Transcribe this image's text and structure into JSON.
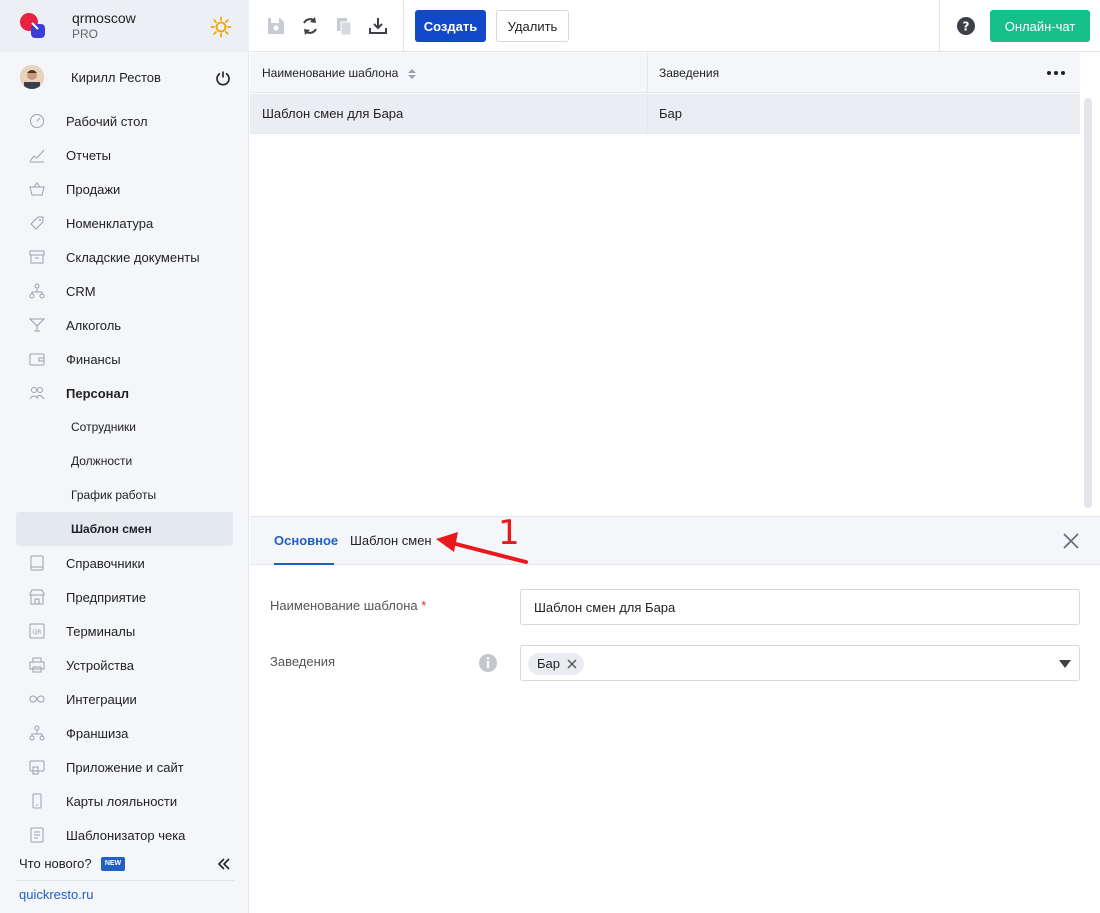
{
  "brand": {
    "name": "qrmoscow",
    "plan": "PRO"
  },
  "user": {
    "name": "Кирилл Рестов"
  },
  "nav": {
    "items": [
      {
        "label": "Рабочий стол",
        "icon": "dashboard-icon"
      },
      {
        "label": "Отчеты",
        "icon": "reports-icon"
      },
      {
        "label": "Продажи",
        "icon": "basket-icon"
      },
      {
        "label": "Номенклатура",
        "icon": "tag-icon"
      },
      {
        "label": "Складские документы",
        "icon": "archive-icon"
      },
      {
        "label": "CRM",
        "icon": "crm-icon"
      },
      {
        "label": "Алкоголь",
        "icon": "cocktail-icon"
      },
      {
        "label": "Финансы",
        "icon": "wallet-icon"
      },
      {
        "label": "Персонал",
        "icon": "people-icon"
      }
    ],
    "sub": [
      {
        "label": "Сотрудники"
      },
      {
        "label": "Должности"
      },
      {
        "label": "График работы"
      },
      {
        "label": "Шаблон смен"
      }
    ],
    "items2": [
      {
        "label": "Справочники",
        "icon": "book-icon"
      },
      {
        "label": "Предприятие",
        "icon": "store-icon"
      },
      {
        "label": "Терминалы",
        "icon": "qr-icon"
      },
      {
        "label": "Устройства",
        "icon": "printer-icon"
      },
      {
        "label": "Интеграции",
        "icon": "infinity-icon"
      },
      {
        "label": "Франшиза",
        "icon": "network-icon"
      },
      {
        "label": "Приложение и сайт",
        "icon": "app-icon"
      },
      {
        "label": "Карты лояльности",
        "icon": "card-icon"
      },
      {
        "label": "Шаблонизатор чека",
        "icon": "receipt-icon"
      }
    ]
  },
  "footer": {
    "whats_new": "Что нового?",
    "badge": "NEW",
    "site": "quickresto.ru"
  },
  "toolbar": {
    "create_label": "Создать",
    "delete_label": "Удалить",
    "chat_label": "Онлайн-чат"
  },
  "grid": {
    "columns": [
      "Наименование шаблона",
      "Заведения"
    ],
    "rows": [
      {
        "name": "Шаблон смен для Бара",
        "venues": "Бар"
      }
    ]
  },
  "detail": {
    "tabs": [
      "Основное",
      "Шаблон смен"
    ],
    "fields": {
      "name_label": "Наименование шаблона",
      "required_mark": "*",
      "name_value": "Шаблон смен для Бара",
      "venues_label": "Заведения",
      "venues_chip": "Бар"
    }
  },
  "annotation": {
    "number": "1",
    "color": "#e8191d"
  },
  "colors": {
    "accent": "#1149c9",
    "chat": "#17c08a",
    "link": "#1f5fc6"
  }
}
